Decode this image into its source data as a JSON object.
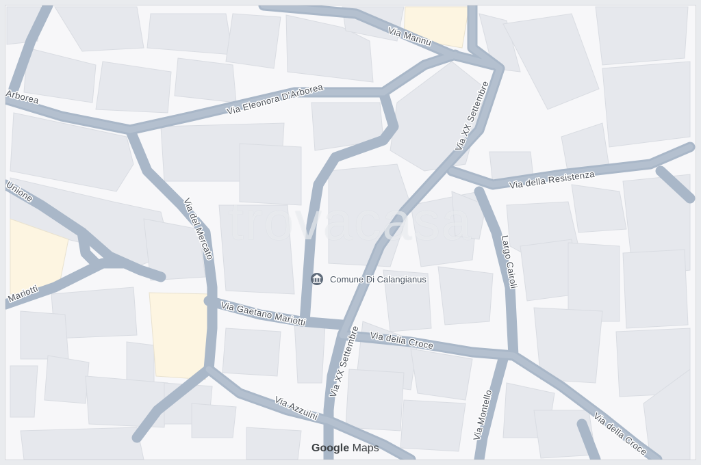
{
  "map": {
    "provider_logo": {
      "google": "Google",
      "maps": "Maps"
    },
    "watermark": "trovacasa",
    "poi": {
      "name": "Comune Di Calangianus",
      "icon": "town-hall-icon"
    },
    "streets": {
      "via_mannu": "Via Mannu",
      "via_xx_settembre_top": "Via XX Settembre",
      "via_eleonora": "Via Eleonora D'Arborea",
      "arborea_left": "Arborea",
      "via_della_resistenza": "Via della Resistenza",
      "unione": "Unione",
      "via_del_mercato": "Via del Mercato",
      "largo_cairoli": "Largo Cairoli",
      "mariotti_left": "Mariotti",
      "via_gaetano_mariotti": "Via Gaetano Mariotti",
      "via_xx_settembre_bottom": "Via XX Settembre",
      "via_della_croce_mid": "Via della Croce",
      "via_azzuini": "Via Azzuini",
      "via_montello": "Via Montello",
      "via_della_croce_right": "Via della Croce"
    },
    "colors": {
      "background": "#f7f7f9",
      "building": "#e6e8ed",
      "building_edge": "#d9dce2",
      "highlight_building": "#fdf5e1",
      "road": "#a9b7c8"
    }
  }
}
